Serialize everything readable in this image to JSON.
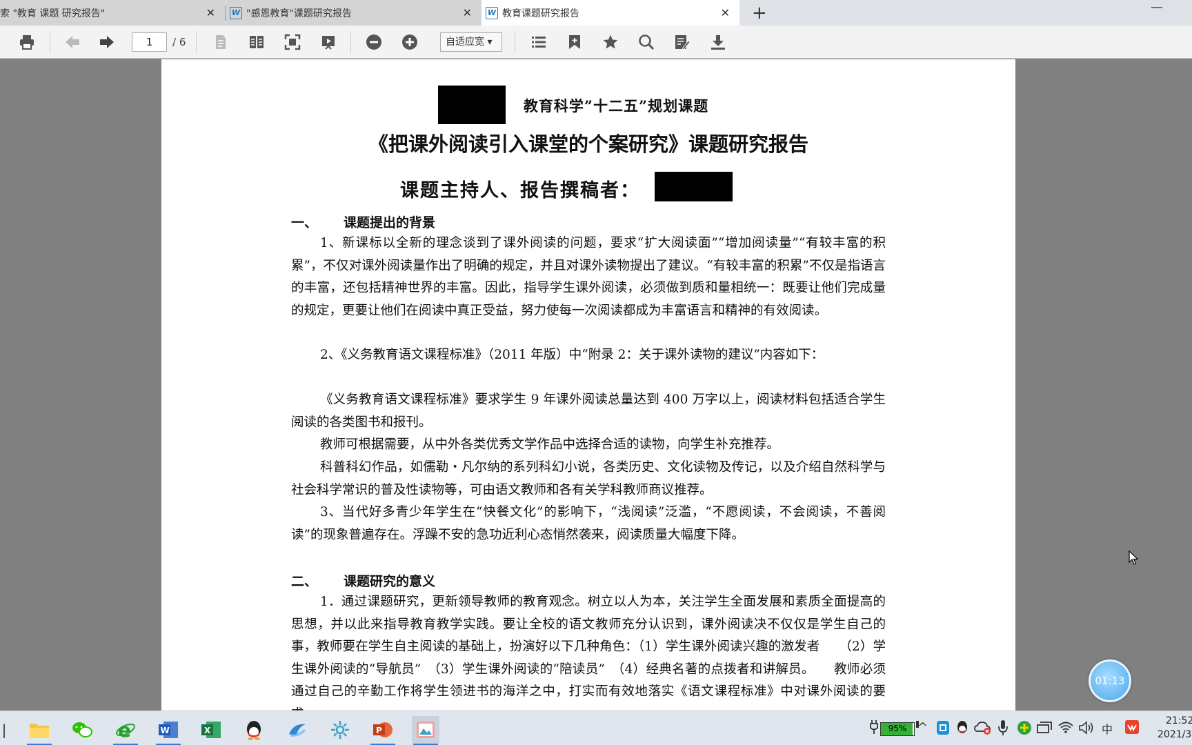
{
  "tabs": [
    {
      "label": "索 \"教育 课题 研究报告\"",
      "has_icon": false
    },
    {
      "label": "\"感恩教育\"课题研究报告",
      "icon": "W"
    },
    {
      "label": "教育课题研究报告",
      "icon": "W"
    }
  ],
  "toolbar": {
    "page_current": "1",
    "page_total": "/ 6",
    "zoom_mode": "自适应宽 ▾"
  },
  "document": {
    "subtitle": "教育科学”十二五”规划课题",
    "title": "《把课外阅读引入课堂的个案研究》课题研究报告",
    "author_label": "课题主持人、报告撰稿者：",
    "sections": [
      {
        "number": "一、",
        "heading": "课题提出的背景",
        "paragraphs": [
          "1、新课标以全新的理念谈到了课外阅读的问题，要求“扩大阅读面”“增加阅读量”“有较丰富的积累”，不仅对课外阅读量作出了明确的规定，并且对课外读物提出了建议。“有较丰富的积累”不仅是指语言的丰富，还包括精神世界的丰富。因此，指导学生课外阅读，必须做到质和量相统一：既要让他们完成量的规定，更要让他们在阅读中真正受益，努力使每一次阅读都成为丰富语言和精神的有效阅读。",
          "2、《义务教育语文课程标准》（2011 年版）中“附录 2：关于课外读物的建议”内容如下：",
          "《义务教育语文课程标准》要求学生 9 年课外阅读总量达到 400 万字以上，阅读材料包括适合学生阅读的各类图书和报刊。",
          "教师可根据需要，从中外各类优秀文学作品中选择合适的读物，向学生补充推荐。",
          "科普科幻作品，如儒勒・凡尔纳的系列科幻小说，各类历史、文化读物及传记，以及介绍自然科学与社会科学常识的普及性读物等，可由语文教师和各有关学科教师商议推荐。",
          "3、当代好多青少年学生在“快餐文化”的影响下，“浅阅读”泛滥，“不愿阅读，不会阅读，不善阅读”的现象普遍存在。浮躁不安的急功近利心态悄然袭来，阅读质量大幅度下降。"
        ]
      },
      {
        "number": "二、",
        "heading": "课题研究的意义",
        "paragraphs": [
          "1．通过课题研究，更新领导教师的教育观念。树立以人为本，关注学生全面发展和素质全面提高的思想，并以此来指导教育教学实践。要让全校的语文教师充分认识到，课外阅读决不仅仅是学生自己的事，教师要在学生自主阅读的基础上，扮演好以下几种角色：（1）学生课外阅读兴趣的激发者　　（2）学生课外阅读的“导航员”　（3）学生课外阅读的“陪读员”　（4）经典名著的点拨者和讲解员。　　教师必须通过自己的辛勤工作将学生领进书的海洋之中，打实而有效地落实《语文课程标准》中对课外阅读的要求。"
        ]
      }
    ]
  },
  "timer": "01:13",
  "tray": {
    "battery": "95%",
    "ime": "中",
    "time": "21:52",
    "date": "2021/3"
  },
  "colors": {
    "accent": "#1a7fc2",
    "page_bg": "#808080",
    "taskbar": "#dfe6ee"
  }
}
